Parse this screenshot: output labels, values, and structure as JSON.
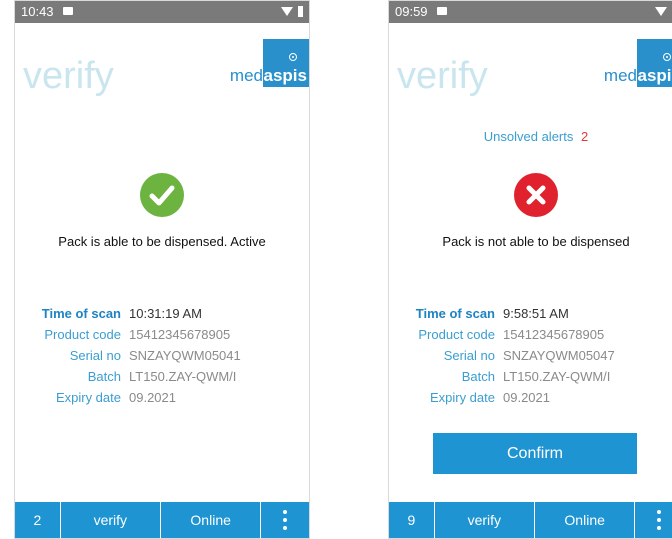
{
  "screens": [
    {
      "status_time": "10:43",
      "app_title": "verify",
      "logo_med": "med",
      "logo_aspis": "aspis",
      "alerts_label": "",
      "alerts_count": "",
      "result": "success",
      "result_icon": "check-icon",
      "result_color": "#6cb33f",
      "result_message": "Pack is able to be dispensed. Active",
      "info": [
        {
          "label": "Time of scan",
          "value": "10:31:19 AM"
        },
        {
          "label": "Product code",
          "value": "15412345678905"
        },
        {
          "label": "Serial no",
          "value": "SNZAYQWM05041"
        },
        {
          "label": "Batch",
          "value": "LT150.ZAY-QWM/I"
        },
        {
          "label": "Expiry date",
          "value": "09.2021"
        }
      ],
      "confirm_label": "",
      "nav": {
        "count": "2",
        "verify": "verify",
        "online": "Online"
      }
    },
    {
      "status_time": "09:59",
      "app_title": "verify",
      "logo_med": "med",
      "logo_aspis": "aspis",
      "alerts_label": "Unsolved alerts",
      "alerts_count": "2",
      "result": "failure",
      "result_icon": "x-icon",
      "result_color": "#e0222f",
      "result_message": "Pack is not able to be dispensed",
      "info": [
        {
          "label": "Time of scan",
          "value": "9:58:51 AM"
        },
        {
          "label": "Product code",
          "value": "15412345678905"
        },
        {
          "label": "Serial no",
          "value": "SNZAYQWM05047"
        },
        {
          "label": "Batch",
          "value": "LT150.ZAY-QWM/I"
        },
        {
          "label": "Expiry date",
          "value": "09.2021"
        }
      ],
      "confirm_label": "Confirm",
      "nav": {
        "count": "9",
        "verify": "verify",
        "online": "Online"
      }
    }
  ],
  "colors": {
    "accent": "#1e94d2",
    "brand": "#2a90cc",
    "title": "#c9e6ee"
  }
}
